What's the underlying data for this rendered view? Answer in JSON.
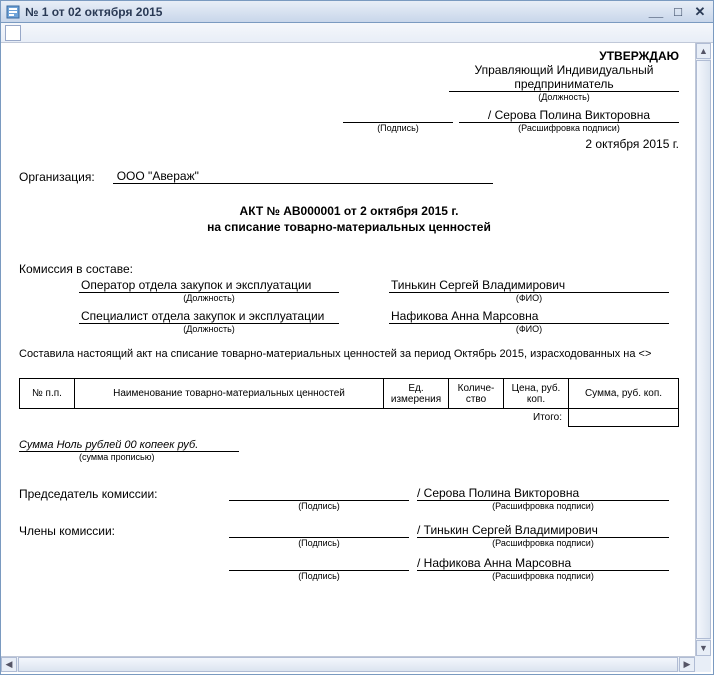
{
  "window": {
    "title": "№ 1 от 02 октября 2015"
  },
  "approve": {
    "title": "УТВЕРЖДАЮ",
    "position": "Управляющий Индивидуальный предприниматель",
    "position_label": "(Должность)",
    "name": "/ Серова Полина Викторовна",
    "sign_label": "(Подпись)",
    "name_label": "(Расшифровка подписи)",
    "date": "2 октября 2015 г."
  },
  "org": {
    "label": "Организация:",
    "value": "ООО \"Авераж\""
  },
  "title": {
    "line1": "АКТ № АВ000001 от 2 октября 2015 г.",
    "line2": "на списание товарно-материальных ценностей"
  },
  "commission": {
    "label": "Комиссия в составе:",
    "role_label": "(Должность)",
    "fio_label": "(ФИО)",
    "members": [
      {
        "role": "Оператор отдела закупок и эксплуатации",
        "name": "Тинькин Сергей Владимирович"
      },
      {
        "role": "Специалист отдела закупок и эксплуатации",
        "name": "Нафикова Анна Марсовна"
      }
    ]
  },
  "body_text": "Составила настоящий акт на списание товарно-материальных ценностей за период Октябрь 2015, израсходованных на <>",
  "table": {
    "headers": {
      "num": "№ п.п.",
      "name": "Наименование товарно-материальных ценностей",
      "unit": "Ед. измерения",
      "qty": "Количе-ство",
      "price": "Цена, руб. коп.",
      "sum": "Сумма, руб. коп."
    },
    "total_label": "Итого:",
    "total_value": ""
  },
  "sum_words": {
    "value": "Сумма Ноль рублей 00 копеек руб.",
    "label": "(сумма прописью)"
  },
  "signatures": {
    "chairman_label": "Председатель комиссии:",
    "members_label": "Члены комиссии:",
    "sign_label": "(Подпись)",
    "name_label": "(Расшифровка подписи)",
    "lines": [
      {
        "name": "/ Серова Полина Викторовна"
      },
      {
        "name": "/ Тинькин Сергей Владимирович"
      },
      {
        "name": "/ Нафикова Анна Марсовна"
      }
    ]
  }
}
